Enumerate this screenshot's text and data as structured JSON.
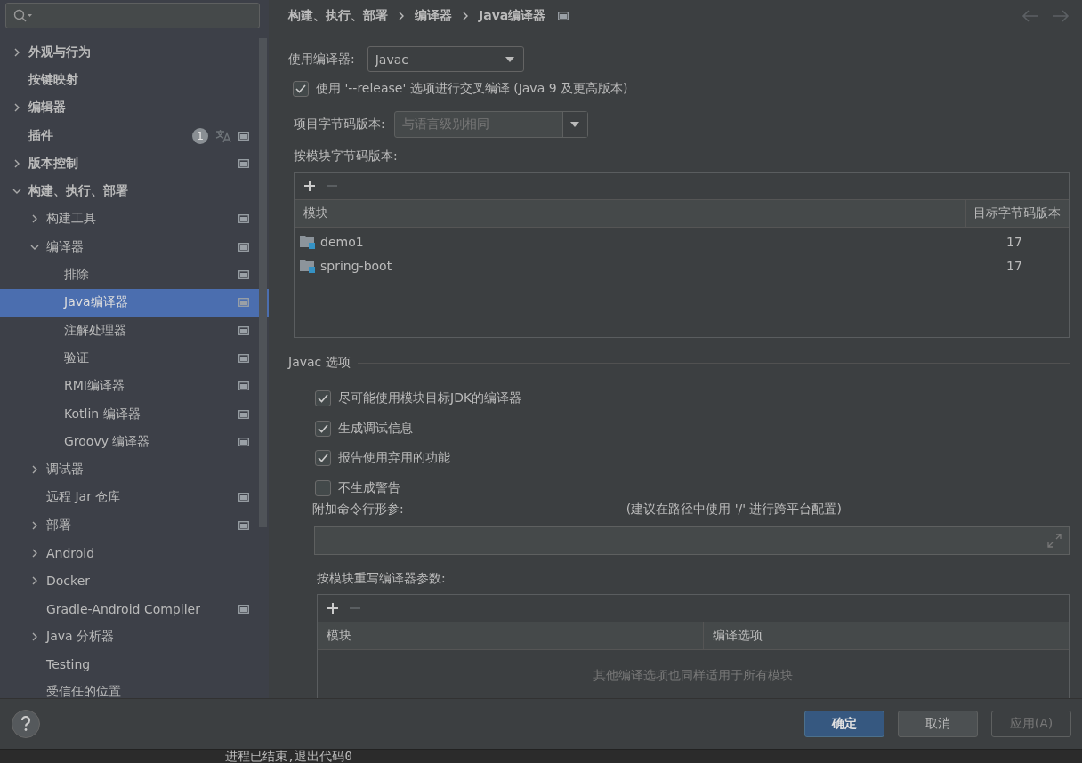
{
  "sidebar": {
    "tree": [
      {
        "label": "外观与行为",
        "expanded": false,
        "selected": false
      },
      {
        "label": "按键映射",
        "selected": false
      },
      {
        "label": "编辑器",
        "expanded": false,
        "selected": false
      },
      {
        "label": "插件",
        "badge": "1",
        "project_level": true,
        "selected": false
      },
      {
        "label": "版本控制",
        "expanded": false,
        "project_level": true,
        "selected": false
      },
      {
        "label": "构建、执行、部署",
        "expanded": true,
        "selected": false,
        "children": [
          {
            "label": "构建工具",
            "expanded": false,
            "project_level": true,
            "selected": false
          },
          {
            "label": "编译器",
            "expanded": true,
            "project_level": true,
            "selected": false,
            "children": [
              {
                "label": "排除",
                "project_level": true,
                "selected": false
              },
              {
                "label": "Java编译器",
                "project_level": true,
                "selected": true
              },
              {
                "label": "注解处理器",
                "project_level": true,
                "selected": false
              },
              {
                "label": "验证",
                "project_level": true,
                "selected": false
              },
              {
                "label": "RMI编译器",
                "project_level": true,
                "selected": false
              },
              {
                "label": "Kotlin 编译器",
                "project_level": true,
                "selected": false
              },
              {
                "label": "Groovy 编译器",
                "project_level": true,
                "selected": false
              }
            ]
          },
          {
            "label": "调试器",
            "expanded": false,
            "selected": false
          },
          {
            "label": "远程 Jar 仓库",
            "project_level": true,
            "selected": false
          },
          {
            "label": "部署",
            "expanded": false,
            "project_level": true,
            "selected": false
          },
          {
            "label": "Android",
            "expanded": false,
            "selected": false
          },
          {
            "label": "Docker",
            "expanded": false,
            "selected": false
          },
          {
            "label": "Gradle-Android Compiler",
            "project_level": true,
            "selected": false
          },
          {
            "label": "Java 分析器",
            "expanded": false,
            "selected": false
          },
          {
            "label": "Testing",
            "selected": false
          },
          {
            "label": "受信任的位置",
            "selected": false
          }
        ]
      }
    ]
  },
  "breadcrumb": [
    "构建、执行、部署",
    "编译器",
    "Java编译器"
  ],
  "compiler": {
    "label": "使用编译器:",
    "value": "Javac"
  },
  "release_option": {
    "label": "使用 '--release' 选项进行交叉编译 (Java 9 及更高版本)",
    "checked": true
  },
  "project_bytecode": {
    "label": "项目字节码版本:",
    "value": "与语言级别相同",
    "disabled": true
  },
  "module_bytecode": {
    "label": "按模块字节码版本:",
    "columns": [
      "模块",
      "目标字节码版本"
    ],
    "rows": [
      {
        "module": "demo1",
        "target": "17"
      },
      {
        "module": "spring-boot",
        "target": "17"
      }
    ]
  },
  "javac_options": {
    "title": "Javac 选项",
    "options": [
      {
        "label": "尽可能使用模块目标JDK的编译器",
        "checked": true
      },
      {
        "label": "生成调试信息",
        "checked": true
      },
      {
        "label": "报告使用弃用的功能",
        "checked": true
      },
      {
        "label": "不生成警告",
        "checked": false
      }
    ],
    "extra_args": {
      "label": "附加命令行形参:",
      "hint": "(建议在路径中使用 '/' 进行跨平台配置)"
    },
    "override": {
      "label": "按模块重写编译器参数:",
      "columns": [
        "模块",
        "编译选项"
      ],
      "empty_text": "其他编译选项也同样适用于所有模块"
    }
  },
  "buttons": [
    {
      "label": "确定",
      "kind": "primary",
      "disabled": false
    },
    {
      "label": "取消",
      "kind": "normal",
      "disabled": false
    },
    {
      "label": "应用(A)",
      "kind": "normal",
      "disabled": true
    }
  ],
  "console": {
    "text": "进程已结束,退出代码0"
  }
}
